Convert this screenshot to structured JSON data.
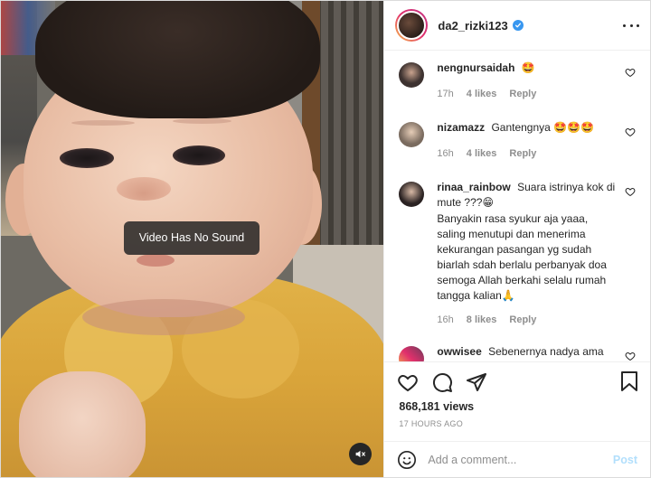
{
  "video": {
    "overlay_text": "Video Has No Sound"
  },
  "header": {
    "username": "da2_rizki123"
  },
  "comments": [
    {
      "username": "nengnursaidah",
      "text": "🤩",
      "time": "17h",
      "likes": "4 likes",
      "reply": "Reply",
      "avatar_color": "#3d3230"
    },
    {
      "username": "nizamazz",
      "text": "Gantengnya 🤩🤩🤩",
      "time": "16h",
      "likes": "4 likes",
      "reply": "Reply",
      "avatar_color": "#7a6b5f"
    },
    {
      "username": "rinaa_rainbow",
      "text": "Suara istrinya kok di mute ???😁",
      "text2": "Banyakin rasa syukur aja yaaa, saling menutupi dan menerima kekurangan pasangan yg sudah biarlah sdah berlalu perbanyak doa semoga Allah berkahi selalu rumah tangga kalian🙏",
      "time": "16h",
      "likes": "8 likes",
      "reply": "Reply",
      "avatar_color": "#2a2222"
    },
    {
      "username": "owwisee",
      "text": "Sebenernya nadya ama rizki udh cerai apa belom si?",
      "avatar_color": "#6b3a5a"
    }
  ],
  "stats": {
    "views": "868,181 views",
    "posted": "17 HOURS AGO"
  },
  "add_comment": {
    "placeholder": "Add a comment...",
    "post_label": "Post"
  },
  "colors": {
    "accent": "#3897f0",
    "post_disabled": "#b2dffc",
    "muted_text": "#8e8e8e"
  }
}
